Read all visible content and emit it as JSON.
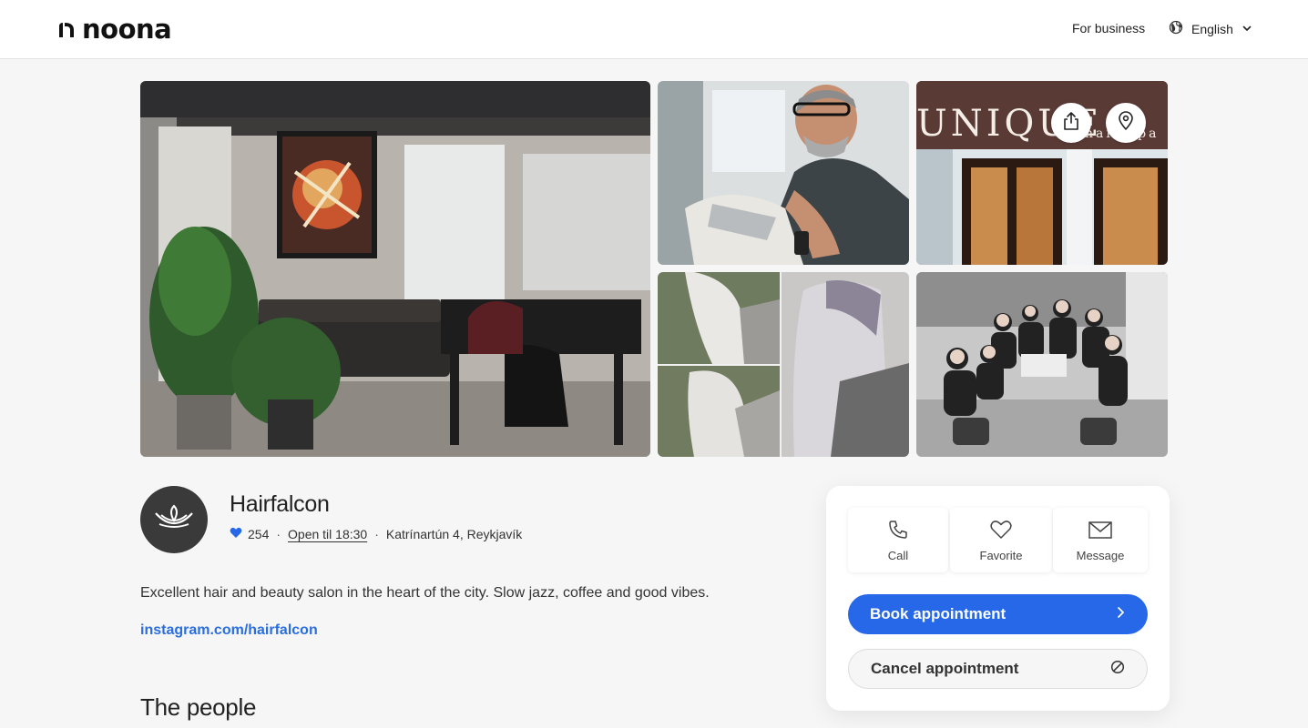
{
  "header": {
    "brand": "noona",
    "for_business": "For business",
    "language": "English"
  },
  "gallery": {
    "photos": [
      "salon-interior",
      "stylist-at-work",
      "storefront",
      "hair-results-collage",
      "team-photo"
    ],
    "storefront_sign": "UNIQUE hair spa"
  },
  "business": {
    "name": "Hairfalcon",
    "favorites": "254",
    "hours": "Open til 18:30",
    "address": "Katrínartún 4, Reykjavík",
    "description": "Excellent hair and beauty salon in the heart of the city. Slow jazz, coffee and good vibes.",
    "link": "instagram.com/hairfalcon"
  },
  "sections": {
    "people_title": "The people"
  },
  "card": {
    "actions": [
      {
        "label": "Call",
        "icon": "phone-icon"
      },
      {
        "label": "Favorite",
        "icon": "heart-icon"
      },
      {
        "label": "Message",
        "icon": "envelope-icon"
      }
    ],
    "book_label": "Book appointment",
    "cancel_label": "Cancel appointment"
  },
  "colors": {
    "accent": "#2668e8",
    "link": "#2a6ee0",
    "heart": "#2668e8"
  }
}
